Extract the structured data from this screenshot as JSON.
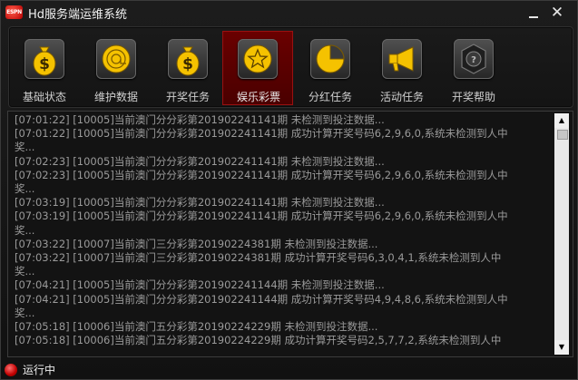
{
  "window": {
    "logo_text": "ESPN",
    "title": "Hd服务端运维系统",
    "minimize_label": "",
    "close_label": "✕"
  },
  "toolbar": {
    "items": [
      {
        "label": "基础状态",
        "icon": "money-bag-icon",
        "active": false
      },
      {
        "label": "维护数据",
        "icon": "at-sign-icon",
        "active": false
      },
      {
        "label": "开奖任务",
        "icon": "money-bag-icon",
        "active": false
      },
      {
        "label": "娱乐彩票",
        "icon": "star-icon",
        "active": true
      },
      {
        "label": "分红任务",
        "icon": "pie-chart-icon",
        "active": false
      },
      {
        "label": "活动任务",
        "icon": "megaphone-icon",
        "active": false
      },
      {
        "label": "开奖帮助",
        "icon": "help-badge-icon",
        "active": false
      }
    ]
  },
  "log": {
    "lines": [
      "[07:01:22] [10005]当前澳门分分彩第201902241141期 未检测到投注数据...",
      "[07:01:22] [10005]当前澳门分分彩第201902241141期 成功计算开奖号码6,2,9,6,0,系统未检测到人中",
      "奖...",
      "[07:02:23] [10005]当前澳门分分彩第201902241141期 未检测到投注数据...",
      "[07:02:23] [10005]当前澳门分分彩第201902241141期 成功计算开奖号码6,2,9,6,0,系统未检测到人中",
      "奖...",
      "[07:03:19] [10005]当前澳门分分彩第201902241141期 未检测到投注数据...",
      "[07:03:19] [10005]当前澳门分分彩第201902241141期 成功计算开奖号码6,2,9,6,0,系统未检测到人中",
      "奖...",
      "[07:03:22] [10007]当前澳门三分彩第20190224381期 未检测到投注数据...",
      "[07:03:22] [10007]当前澳门三分彩第20190224381期 成功计算开奖号码6,3,0,4,1,系统未检测到人中",
      "奖...",
      "[07:04:21] [10005]当前澳门分分彩第201902241144期 未检测到投注数据...",
      "[07:04:21] [10005]当前澳门分分彩第201902241144期 成功计算开奖号码4,9,4,8,6,系统未检测到人中",
      "奖...",
      "[07:05:18] [10006]当前澳门五分彩第20190224229期 未检测到投注数据...",
      "[07:05:18] [10006]当前澳门五分彩第20190224229期 成功计算开奖号码2,5,7,7,2,系统未检测到人中"
    ]
  },
  "status": {
    "text": "运行中",
    "color": "#d00000"
  },
  "colors": {
    "accent_active": "#6a0000",
    "icon_gold": "#f5c200",
    "log_text": "#9a9a9a"
  }
}
